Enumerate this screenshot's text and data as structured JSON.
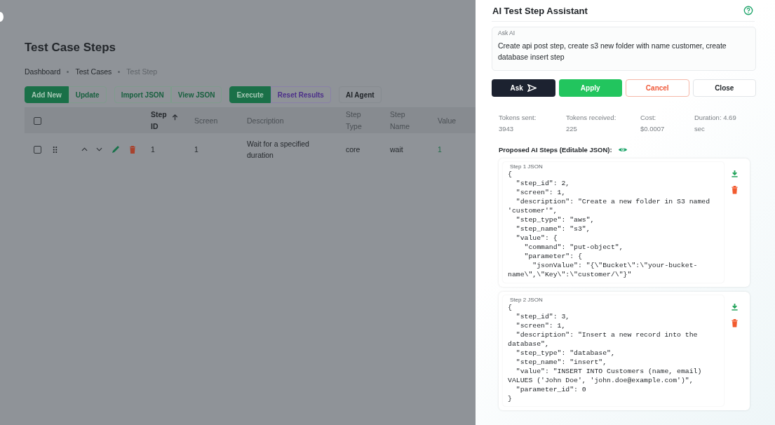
{
  "page": {
    "title": "Test Case Steps",
    "breadcrumbs": [
      {
        "label": "Dashboard",
        "current": false
      },
      {
        "label": "Test Cases",
        "current": false
      },
      {
        "label": "Test Step",
        "current": true
      }
    ],
    "button_groups": [
      {
        "buttons": [
          {
            "label": "Add New"
          },
          {
            "label": "Update"
          }
        ]
      },
      {
        "buttons": [
          {
            "label": "Import JSON"
          },
          {
            "label": "View JSON"
          }
        ]
      },
      {
        "buttons": [
          {
            "label": "Execute"
          },
          {
            "label": "Reset Results"
          }
        ]
      },
      {
        "buttons": [
          {
            "label": "AI Agent"
          }
        ]
      }
    ],
    "table": {
      "columns": [
        {
          "label": "Step ID",
          "sorted": true
        },
        {
          "label": "Screen",
          "sorted": false
        },
        {
          "label": "Description",
          "sorted": false
        },
        {
          "label": "Step Type",
          "sorted": false
        },
        {
          "label": "Step Name",
          "sorted": false
        },
        {
          "label": "Value",
          "sorted": false
        }
      ],
      "header_checked": false,
      "rows": [
        {
          "checked": false,
          "cells": [
            "1",
            "1",
            "Wait for a specified duration",
            "core",
            "wait",
            "1"
          ]
        }
      ]
    }
  },
  "assistant": {
    "title": "AI Test Step Assistant",
    "ask": {
      "label": "Ask AI",
      "value": "Create api post step, create s3 new folder with name customer, create database insert step"
    },
    "buttons": [
      {
        "label": "Ask",
        "kind": "ask"
      },
      {
        "label": "Apply",
        "kind": "apply"
      },
      {
        "label": "Cancel",
        "kind": "cancel"
      },
      {
        "label": "Close",
        "kind": "close"
      }
    ],
    "stats": [
      {
        "label": "Tokens sent:",
        "value": "3943"
      },
      {
        "label": "Tokens received:",
        "value": "225"
      },
      {
        "label": "Cost:",
        "value": "$0.0007"
      },
      {
        "label": "Duration: 4.69",
        "value": "sec"
      }
    ],
    "proposed_label": "Proposed AI Steps (Editable JSON):",
    "steps": [
      {
        "label": "Step 1 JSON",
        "json": "{\n  \"step_id\": 2,\n  \"screen\": 1,\n  \"description\": \"Create a new folder in S3 named 'customer'\",\n  \"step_type\": \"aws\",\n  \"step_name\": \"s3\",\n  \"value\": {\n    \"command\": \"put-object\",\n    \"parameter\": {\n      \"jsonValue\": \"{\\\"Bucket\\\":\\\"your-bucket-name\\\",\\\"Key\\\":\\\"customer/\\\"}\""
      },
      {
        "label": "Step 2 JSON",
        "json": "{\n  \"step_id\": 3,\n  \"screen\": 1,\n  \"description\": \"Insert a new record into the database\",\n  \"step_type\": \"database\",\n  \"step_name\": \"insert\",\n  \"value\": \"INSERT INTO Customers (name, email) VALUES ('John Doe', 'john.doe@example.com')\",\n  \"parameter_id\": 0\n}"
      }
    ]
  }
}
